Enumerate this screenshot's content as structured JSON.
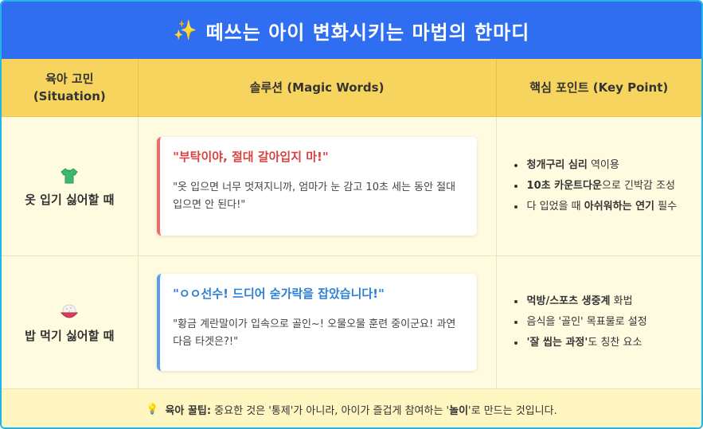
{
  "header": {
    "title": "떼쓰는 아이 변화시키는 마법의 한마디",
    "icon": "sparkles-icon"
  },
  "columns": {
    "situation_line1": "육아 고민",
    "situation_line2": "(Situation)",
    "solution": "솔루션 (Magic Words)",
    "keypoint": "핵심 포인트 (Key Point)"
  },
  "rows": [
    {
      "situation": "옷 입기 싫어할 때",
      "icon": "tshirt-icon",
      "magic": "\"부탁이야, 절대 갈아입지 마!\"",
      "desc": "\"옷 입으면 너무 멋져지니까, 엄마가 눈 감고 10초 세는 동안 절대 입으면 안 된다!\"",
      "points": [
        {
          "bold": "청개구리 심리",
          "rest": " 역이용"
        },
        {
          "bold": "10초 카운트다운",
          "rest": "으로 긴박감 조성"
        },
        {
          "pre": "다 입었을 때 ",
          "bold": "아쉬워하는 연기",
          "rest": " 필수"
        }
      ]
    },
    {
      "situation": "밥 먹기 싫어할 때",
      "icon": "rice-bowl-icon",
      "magic": "\"ㅇㅇ선수! 드디어 숟가락을 잡았습니다!\"",
      "desc": "\"황금 계란말이가 입속으로 골인~! 오물오물 훈련 중이군요! 과연 다음 타겟은?!\"",
      "points": [
        {
          "bold": "먹방/스포츠 생중계",
          "rest": " 화법"
        },
        {
          "pre": "음식을 '골인' 목표물로 설정"
        },
        {
          "bold": "'잘 씹는 과정'",
          "rest": "도 칭찬 요소"
        }
      ]
    }
  ],
  "footer": {
    "icon": "lightbulb-icon",
    "label": "육아 꿀팁:",
    "text1": " 중요한 것은 '통제'가 아니라, 아이가 즐겁게 참여하는 '",
    "bold": "놀이",
    "text2": "'로 만드는 것입니다."
  },
  "colors": {
    "header_bg": "#2f6ef0",
    "column_bg": "#f7d45e",
    "row_bg": "#fffbe0",
    "red_accent": "#f06a6a",
    "blue_accent": "#5b9cf0"
  }
}
